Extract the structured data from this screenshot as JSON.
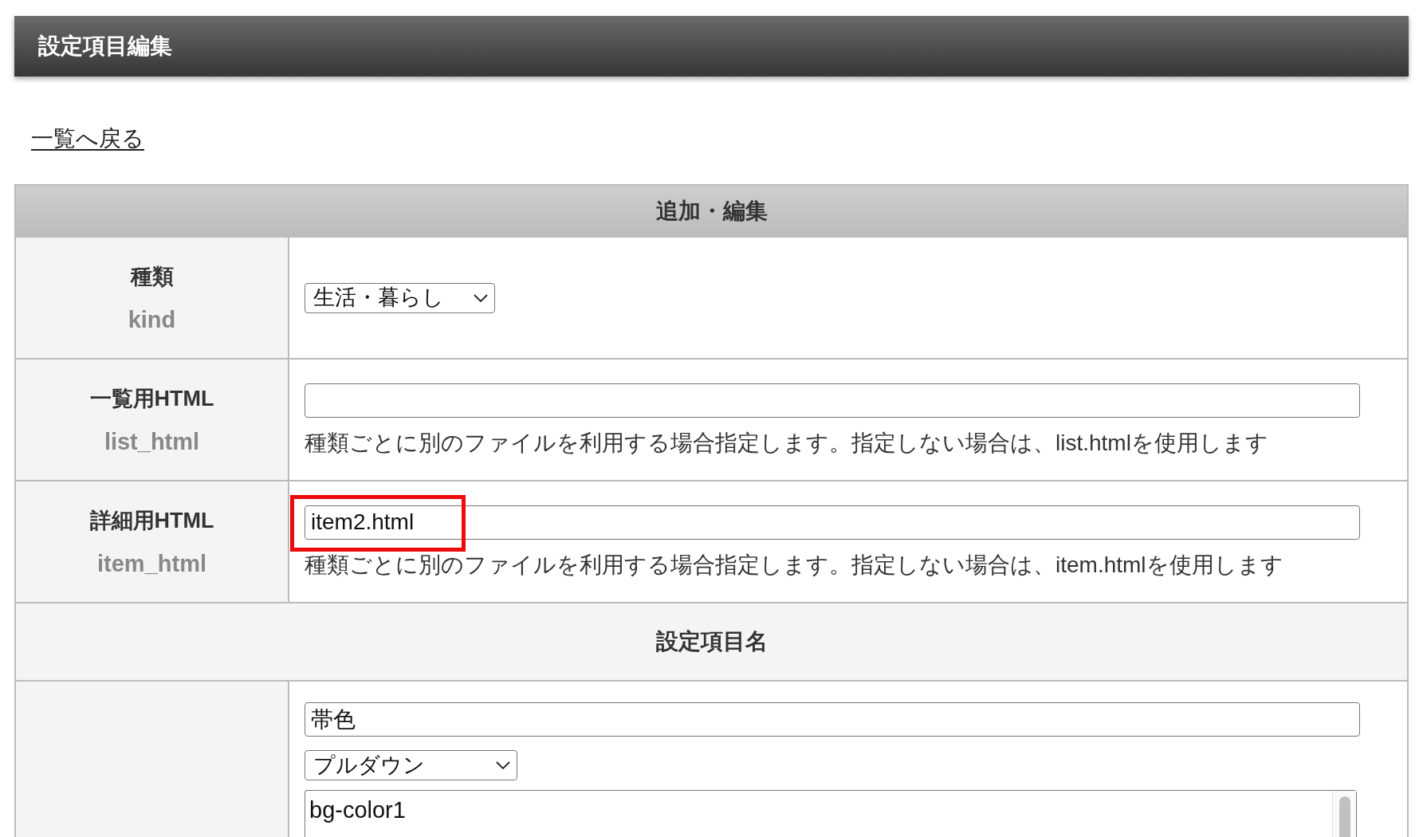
{
  "header": {
    "title": "設定項目編集"
  },
  "back_link": {
    "label": "一覧へ戻る"
  },
  "form": {
    "heading": "追加・編集",
    "rows": [
      {
        "kind": "select",
        "label": "種類",
        "sublabel": "kind",
        "value": "生活・暮らし",
        "highlighted": false
      },
      {
        "kind": "text",
        "label": "一覧用HTML",
        "sublabel": "list_html",
        "hint": "種類ごとに別のファイルを利用する場合指定します。指定しない場合は、list.htmlを使用します",
        "highlighted": false
      },
      {
        "kind": "text",
        "label": "詳細用HTML",
        "sublabel": "item_html",
        "value": "item2.html",
        "hint": "種類ごとに別のファイルを利用する場合指定します。指定しない場合は、item.htmlを使用します",
        "highlighted": true
      }
    ]
  },
  "settings": {
    "heading": "設定項目名",
    "items": [
      {
        "name": "帯色",
        "input_type": "プルダウン",
        "options": [
          "bg-color1"
        ]
      }
    ]
  }
}
